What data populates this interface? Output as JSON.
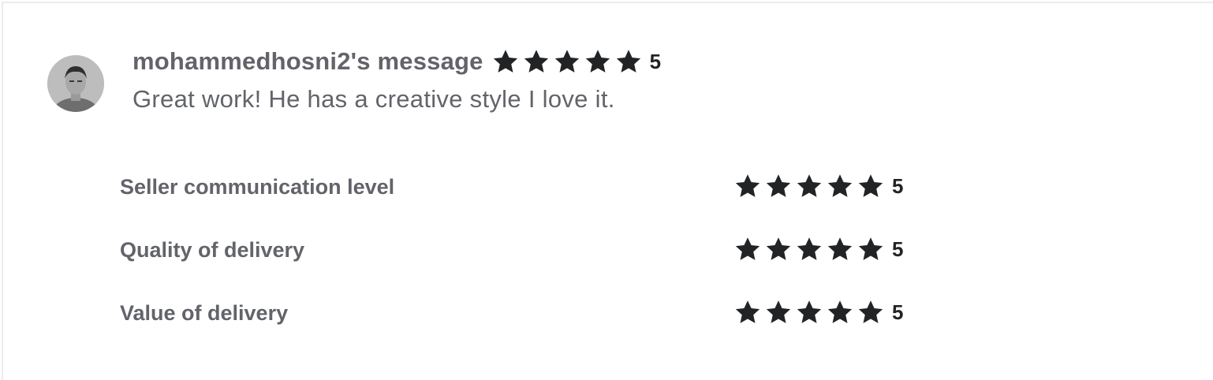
{
  "review": {
    "username_label": "mohammedhosni2's message",
    "overall_rating": 5,
    "overall_score": "5",
    "message": "Great work! He has a creative style I love it.",
    "avatar_icon": "user-avatar-photo"
  },
  "ratings": [
    {
      "label": "Seller communication level",
      "rating": 5,
      "score": "5"
    },
    {
      "label": "Quality of delivery",
      "rating": 5,
      "score": "5"
    },
    {
      "label": "Value of delivery",
      "rating": 5,
      "score": "5"
    }
  ],
  "colors": {
    "star": "#222325",
    "text_muted": "#62646a",
    "border": "#ececec"
  },
  "icons": {
    "star": "star-icon"
  }
}
